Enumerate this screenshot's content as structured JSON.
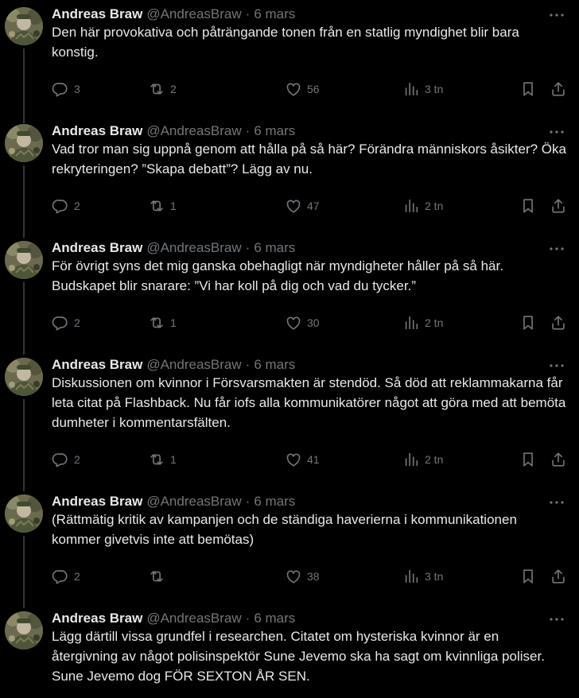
{
  "colors": {
    "background": "#000000",
    "text": "#e7e9ea",
    "muted": "#71767b",
    "thread_line": "#333639"
  },
  "tweets": [
    {
      "name": "Andreas Braw",
      "handle": "@AndreasBraw",
      "separator": "·",
      "date": "6 mars",
      "text": "Den här provokativa och påträngande tonen från en statlig myndighet blir bara konstig.",
      "replies": "3",
      "reposts": "2",
      "likes": "56",
      "views": "3 tn"
    },
    {
      "name": "Andreas Braw",
      "handle": "@AndreasBraw",
      "separator": "·",
      "date": "6 mars",
      "text": "Vad tror man sig uppnå genom att hålla på så här? Förändra människors åsikter? Öka rekryteringen? ”Skapa debatt”? Lägg av nu.",
      "replies": "2",
      "reposts": "1",
      "likes": "47",
      "views": "2 tn"
    },
    {
      "name": "Andreas Braw",
      "handle": "@AndreasBraw",
      "separator": "·",
      "date": "6 mars",
      "text": "För övrigt syns det mig ganska obehagligt när myndigheter håller på så här. Budskapet blir snarare: ”Vi har koll på dig och vad du tycker.”",
      "replies": "2",
      "reposts": "1",
      "likes": "30",
      "views": "2 tn"
    },
    {
      "name": "Andreas Braw",
      "handle": "@AndreasBraw",
      "separator": "·",
      "date": "6 mars",
      "text": "Diskussionen om kvinnor i Försvarsmakten är stendöd. Så död att reklammakarna får leta citat på Flashback. Nu får iofs alla kommunikatörer något att göra med att bemöta dumheter i kommentarsfälten.",
      "replies": "2",
      "reposts": "1",
      "likes": "41",
      "views": "2 tn"
    },
    {
      "name": "Andreas Braw",
      "handle": "@AndreasBraw",
      "separator": "·",
      "date": "6 mars",
      "text": "(Rättmätig kritik av kampanjen och de ständiga haverierna i kommunikationen kommer givetvis inte att bemötas)",
      "replies": "2",
      "reposts": "",
      "likes": "38",
      "views": "3 tn"
    },
    {
      "name": "Andreas Braw",
      "handle": "@AndreasBraw",
      "separator": "·",
      "date": "6 mars",
      "text": "Lägg därtill vissa grundfel i researchen. Citatet om hysteriska kvinnor är en återgivning av något polisinspektör Sune Jevemo ska ha sagt om kvinnliga poliser. Sune Jevemo dog FÖR SEXTON ÅR SEN."
    }
  ]
}
